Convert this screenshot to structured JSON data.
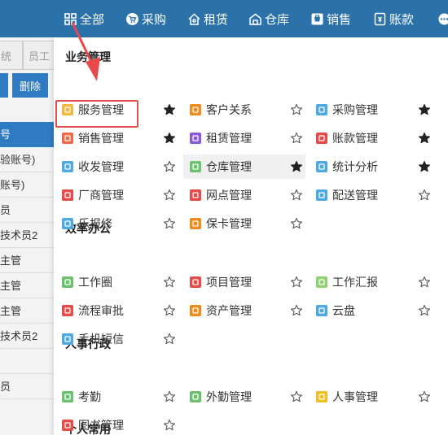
{
  "colors": {
    "nav_bg": "#2a72a9",
    "accent": "#2f7bc2",
    "annotation_red": "#e05050"
  },
  "topnav": [
    {
      "label": "全部",
      "icon": "grid-icon"
    },
    {
      "label": "采购",
      "icon": "cart-icon"
    },
    {
      "label": "租赁",
      "icon": "house-icon"
    },
    {
      "label": "仓库",
      "icon": "warehouse-icon"
    },
    {
      "label": "销售",
      "icon": "shop-icon"
    },
    {
      "label": "账款",
      "icon": "ledger-icon"
    }
  ],
  "left_panel": {
    "tabs": [
      "统",
      "员工"
    ],
    "buttons": [
      "",
      "删除"
    ],
    "rows": [
      "号",
      "验账号)",
      "账号)",
      "员",
      "技术员2",
      "主管",
      "主管",
      "主管",
      "技术员2",
      "",
      "员"
    ]
  },
  "sections": [
    {
      "title": "业务管理"
    },
    {
      "title": "效率办公"
    },
    {
      "title": "人事行政"
    },
    {
      "title": "个人常用"
    }
  ],
  "items": [
    {
      "label": "服务管理",
      "icon": "service-icon",
      "color": "#f0b840",
      "starred": true
    },
    {
      "label": "客户关系",
      "icon": "customer-icon",
      "color": "#f08a1c",
      "starred": false
    },
    {
      "label": "采购管理",
      "icon": "purchase-icon",
      "color": "#4fa8e0",
      "starred": true
    },
    {
      "label": "销售管理",
      "icon": "sales-icon",
      "color": "#f06a4a",
      "starred": true
    },
    {
      "label": "租赁管理",
      "icon": "lease-icon",
      "color": "#8a5ad8",
      "starred": false
    },
    {
      "label": "账款管理",
      "icon": "account-icon",
      "color": "#e84a4a",
      "starred": true
    },
    {
      "label": "收发管理",
      "icon": "transfer-icon",
      "color": "#4fa8e0",
      "starred": false
    },
    {
      "label": "仓库管理",
      "icon": "warehouse-icon",
      "color": "#6cc070",
      "starred": true
    },
    {
      "label": "统计分析",
      "icon": "stats-icon",
      "color": "#4fa8e0",
      "starred": true
    },
    {
      "label": "厂商管理",
      "icon": "vendor-icon",
      "color": "#e84a4a",
      "starred": false
    },
    {
      "label": "网点管理",
      "icon": "branch-icon",
      "color": "#e84a4a",
      "starred": false
    },
    {
      "label": "配送管理",
      "icon": "delivery-icon",
      "color": "#4fa8e0",
      "starred": false
    },
    {
      "label": "乐报修",
      "icon": "repair-icon",
      "color": "#4fa8e0",
      "starred": false
    },
    {
      "label": "保卡管理",
      "icon": "warranty-icon",
      "color": "#f08a1c",
      "starred": false
    },
    {
      "label": "工作圈",
      "icon": "circle-icon",
      "color": "#6cc070",
      "starred": false
    },
    {
      "label": "项目管理",
      "icon": "project-icon",
      "color": "#e84a4a",
      "starred": false
    },
    {
      "label": "工作汇报",
      "icon": "report-icon",
      "color": "#8fd070",
      "starred": false
    },
    {
      "label": "流程审批",
      "icon": "approval-icon",
      "color": "#e84a4a",
      "starred": false
    },
    {
      "label": "资产管理",
      "icon": "asset-icon",
      "color": "#f08a1c",
      "starred": false
    },
    {
      "label": "云盘",
      "icon": "cloud-icon",
      "color": "#4fa8e0",
      "starred": false
    },
    {
      "label": "手机短信",
      "icon": "sms-icon",
      "color": "#4fa8e0",
      "starred": false
    },
    {
      "label": "考勤",
      "icon": "attendance-icon",
      "color": "#6cc070",
      "starred": false
    },
    {
      "label": "外勤管理",
      "icon": "field-icon",
      "color": "#6cc070",
      "starred": false
    },
    {
      "label": "人事管理",
      "icon": "hr-icon",
      "color": "#f0c020",
      "starred": false
    },
    {
      "label": "图书管理",
      "icon": "book-icon",
      "color": "#e84a4a",
      "starred": false
    }
  ],
  "highlighted_item": "仓库管理",
  "annotated_item": "销售管理"
}
